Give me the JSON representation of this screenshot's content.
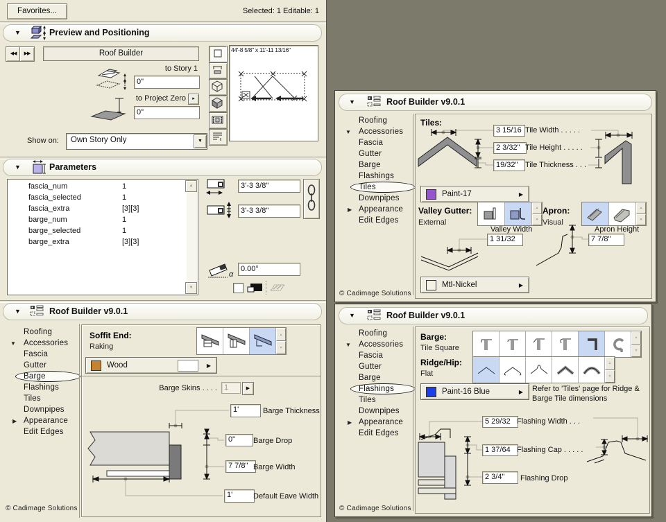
{
  "colors": {
    "desktop_bg": "#7B7A6B",
    "panel_bg": "#ECE9D8",
    "selection_blue": "#C9D9F3",
    "swatch_wood": "#C5832F",
    "swatch_paint17": "#9455CE",
    "swatch_mtl_nickel": "#F4F1E5",
    "swatch_paint16_blue": "#1C3FE8"
  },
  "icons": {
    "collapse": "▼",
    "expand": "▶",
    "prev": "◀◀",
    "next": "▶▶",
    "combo_arrow": "▼",
    "menu_arrow": "▶",
    "spin_up": "▲",
    "spin_down": "▼",
    "scroll_up": "▲",
    "scroll_down": "▼",
    "alpha": "α",
    "mini_arrow": "▸"
  },
  "header": {
    "favorites": "Favorites...",
    "status": "Selected: 1 Editable: 1"
  },
  "preview_positioning": {
    "title": "Preview and Positioning",
    "element_name": "Roof Builder",
    "to_story": "to Story 1",
    "story_offset": "0\"",
    "to_project_zero": "to Project Zero",
    "project_offset": "0\"",
    "show_on_label": "Show on:",
    "show_on_value": "Own Story Only",
    "preview_dims": "44'-8 5/8\" x 11'-11 13/16\""
  },
  "parameters": {
    "title": "Parameters",
    "rows": [
      {
        "name": "fascia_num",
        "value": "1"
      },
      {
        "name": "fascia_selected",
        "value": "1"
      },
      {
        "name": "fascia_extra",
        "value": "[3][3]"
      },
      {
        "name": "barge_num",
        "value": "1"
      },
      {
        "name": "barge_selected",
        "value": "1"
      },
      {
        "name": "barge_extra",
        "value": "[3][3]"
      }
    ],
    "width_value": "3'-3 3/8\"",
    "height_value": "3'-3 3/8\"",
    "angle_value": "0.00°"
  },
  "tree_items": [
    "Roofing",
    "Accessories",
    "Fascia",
    "Gutter",
    "Barge",
    "Flashings",
    "Tiles",
    "Downpipes",
    "Appearance",
    "Edit Edges"
  ],
  "footer": "© Cadimage Solutions",
  "panel_barge": {
    "title": "Roof Builder v9.0.1",
    "selected_tree_item": "Barge",
    "soffit_end_label": "Soffit End:",
    "soffit_end_value": "Raking",
    "material": "Wood",
    "barge_skins_label": "Barge Skins . . . .",
    "barge_skins_value": "1",
    "barge_thickness": {
      "value": "1'",
      "label": "Barge Thickness"
    },
    "barge_drop": {
      "value": "0\"",
      "label": "Barge Drop"
    },
    "barge_width": {
      "value": "7 7/8\"",
      "label": "Barge Width"
    },
    "default_eave_width": {
      "value": "1'",
      "label": "Default Eave Width"
    }
  },
  "panel_tiles": {
    "title": "Roof Builder v9.0.1",
    "selected_tree_item": "Tiles",
    "section_label": "Tiles:",
    "tile_width": {
      "value": "3 15/16",
      "label": "Tile Width . . . . ."
    },
    "tile_height": {
      "value": "2 3/32\"",
      "label": "Tile Height . . . . ."
    },
    "tile_thickness": {
      "value": "19/32\"",
      "label": "Tile Thickness . . ."
    },
    "material": "Paint-17",
    "valley_gutter_label": "Valley Gutter:",
    "valley_gutter_value": "External",
    "apron_label": "Apron:",
    "apron_value": "Visual",
    "valley_width_label": "Valley Width",
    "valley_width_value": "1 31/32",
    "apron_height_label": "Apron Height",
    "apron_height_value": "7 7/8\"",
    "material2": "Mtl-Nickel"
  },
  "panel_flashings": {
    "title": "Roof Builder v9.0.1",
    "selected_tree_item": "Flashings",
    "barge_label": "Barge:",
    "barge_value": "Tile Square",
    "ridge_label": "Ridge/Hip:",
    "ridge_value": "Flat",
    "material": "Paint-16 Blue",
    "note_line1": "Refer to 'Tiles' page for Ridge &",
    "note_line2": "Barge Tile dimensions",
    "flashing_width": {
      "value": "5 29/32",
      "label": "Flashing Width . . ."
    },
    "flashing_cap": {
      "value": "1 37/64",
      "label": "Flashing Cap . . . . ."
    },
    "flashing_drop": {
      "value": "2 3/4\"",
      "label": "Flashing Drop"
    }
  }
}
